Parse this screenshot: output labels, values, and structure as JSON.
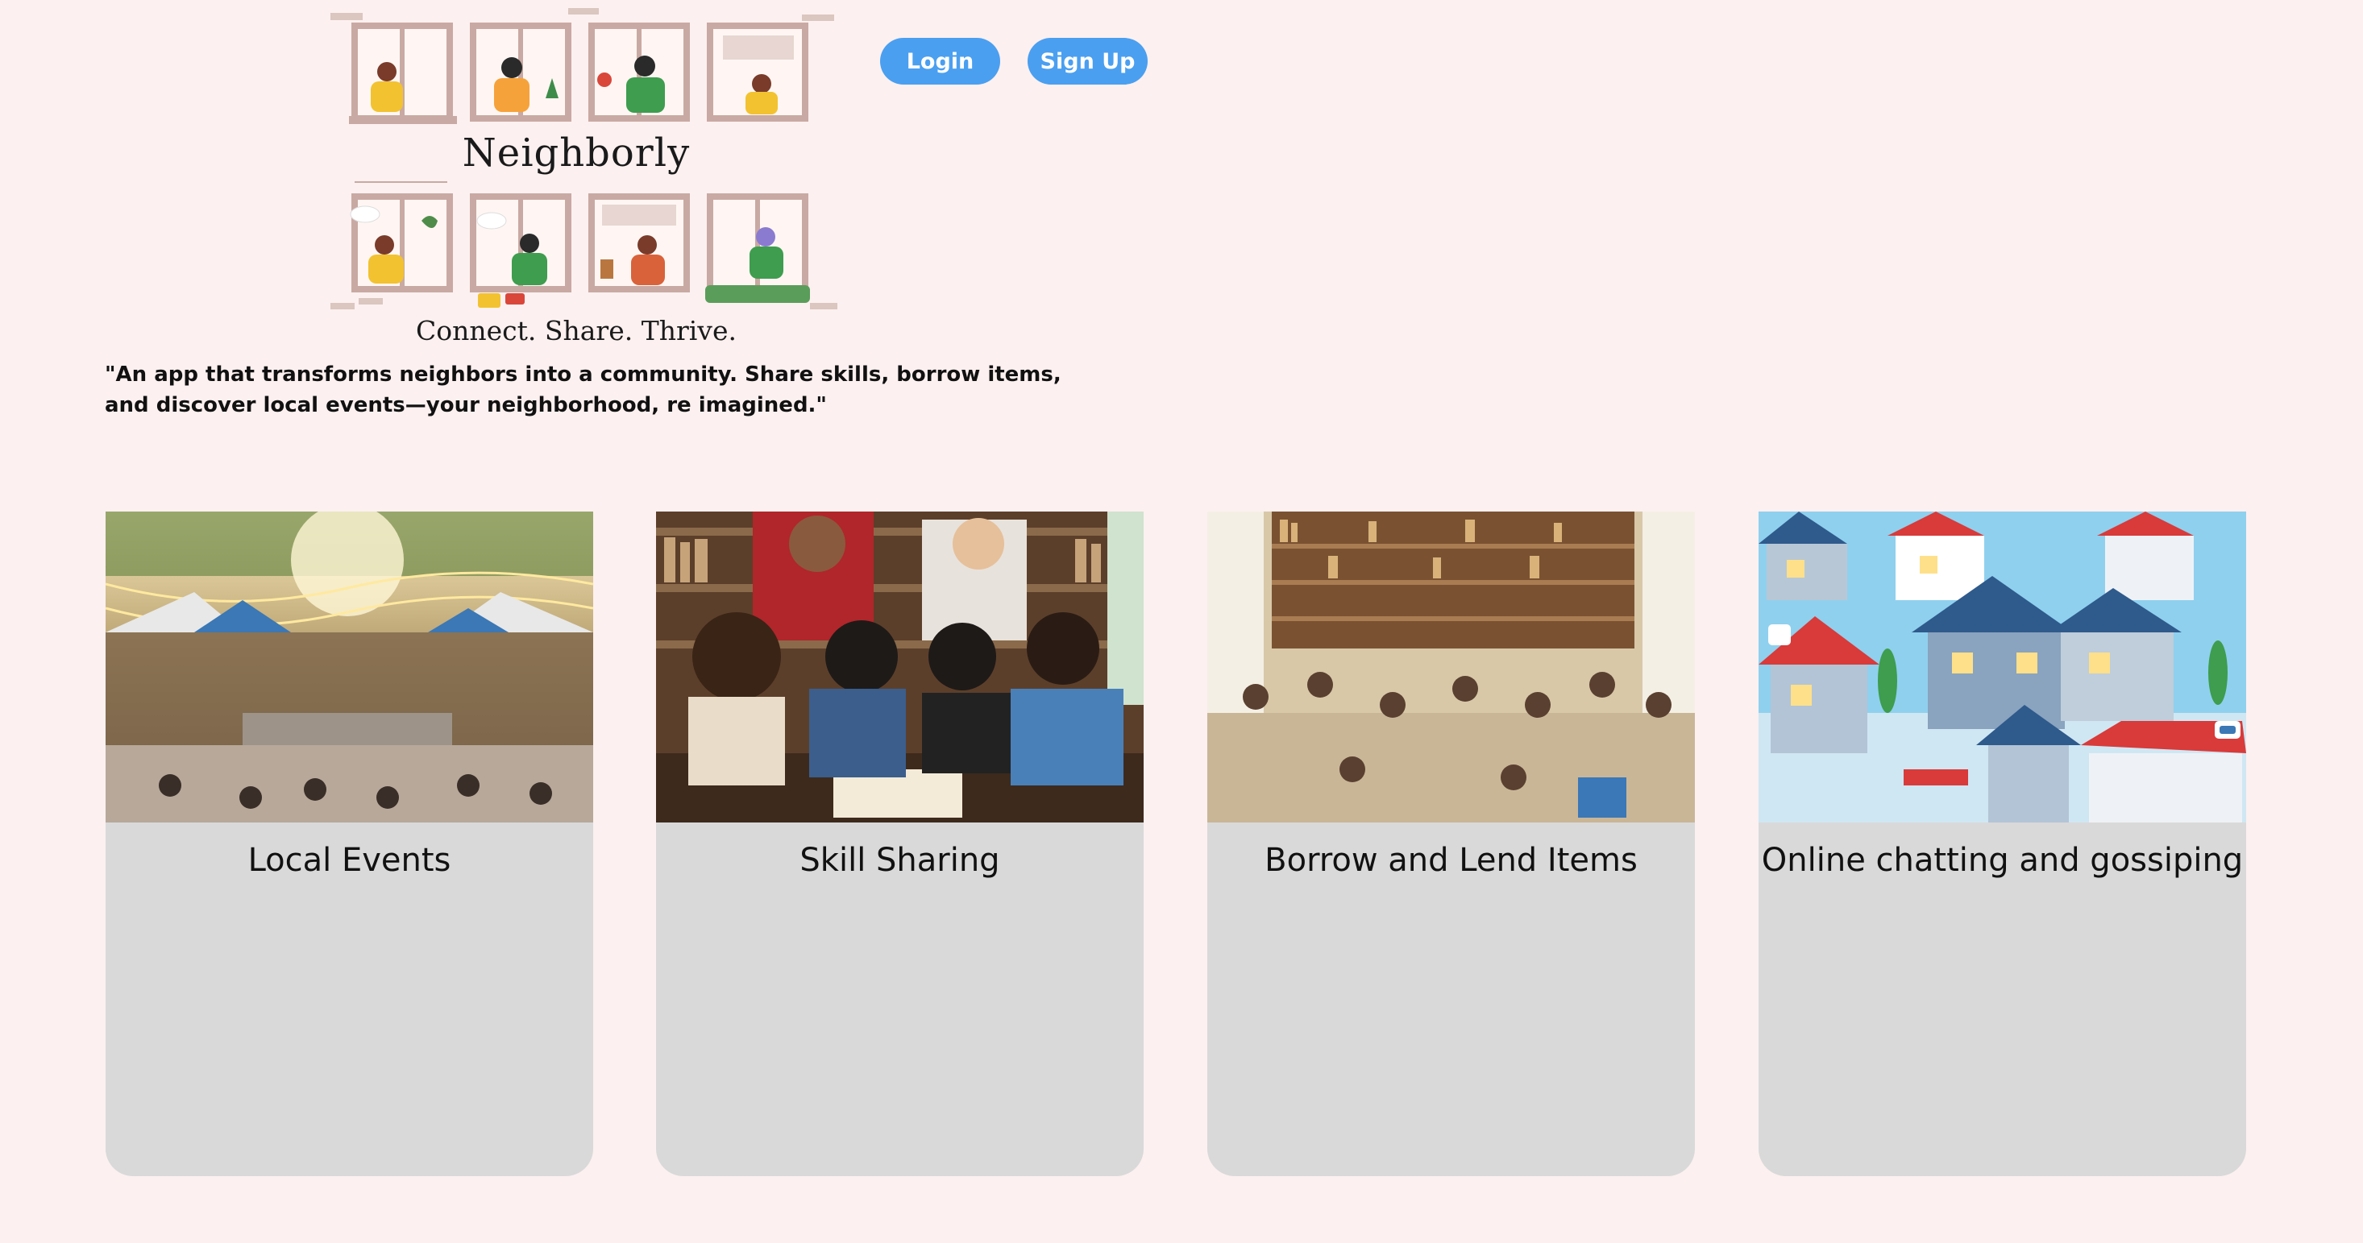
{
  "brand": {
    "name": "Neighborly",
    "tagline": "Connect. Share. Thrive."
  },
  "auth": {
    "login_label": "Login",
    "signup_label": "Sign Up"
  },
  "intro": {
    "text": "\"An app that transforms neighbors into a community. Share skills, borrow items, and discover local events—your neighborhood, re imagined.\""
  },
  "features": [
    {
      "title": "Local Events",
      "image": "outdoor-event-crowd-image"
    },
    {
      "title": "Skill Sharing",
      "image": "group-study-table-image"
    },
    {
      "title": "Borrow and Lend Items",
      "image": "community-library-image"
    },
    {
      "title": "Online chatting and gossiping",
      "image": "neighborhood-houses-illustration"
    }
  ],
  "colors": {
    "page_background": "#fcf0f0",
    "button_blue": "#4a9ff0",
    "card_gray": "#d9d9d9"
  }
}
